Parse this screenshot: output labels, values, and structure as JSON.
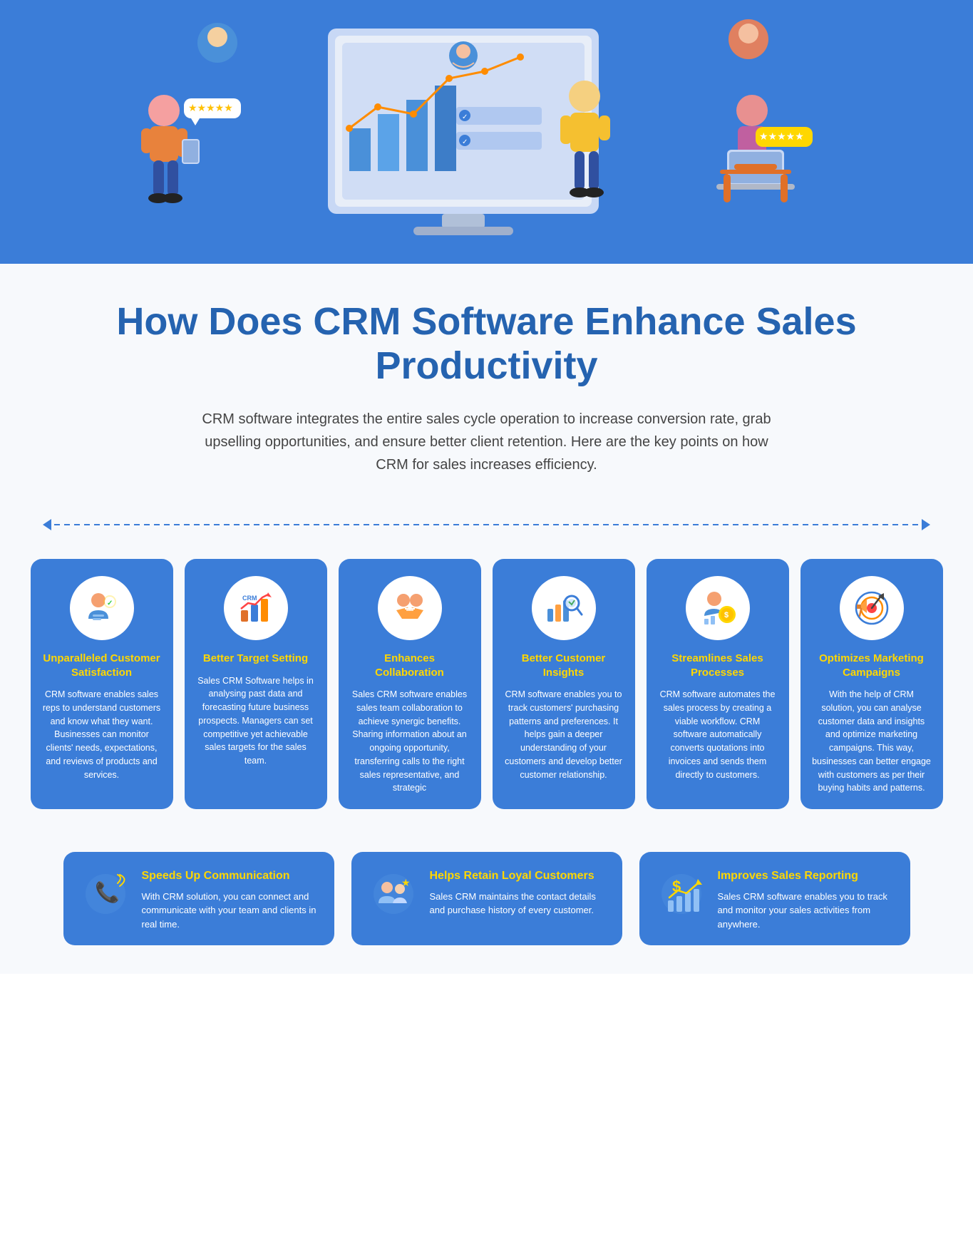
{
  "hero": {
    "alt": "CRM Software illustration with people and monitor"
  },
  "title": {
    "main": "How Does CRM Software Enhance Sales Productivity",
    "subtitle": "CRM software integrates the entire sales cycle operation to increase conversion rate, grab upselling opportunities, and ensure better client retention. Here are the key points on how CRM for sales increases efficiency."
  },
  "cards": [
    {
      "id": "unparalleled-customer-satisfaction",
      "title": "Unparalleled Customer Satisfaction",
      "body": "CRM software enables sales reps to understand customers and know what they want. Businesses can monitor clients' needs, expectations, and reviews of products and services.",
      "icon": "person-checkmark"
    },
    {
      "id": "better-target-setting",
      "title": "Better Target Setting",
      "body": "Sales CRM Software helps in analysing past data and forecasting future business prospects. Managers can set competitive yet achievable sales targets for the sales team.",
      "icon": "crm-chart"
    },
    {
      "id": "enhances-collaboration",
      "title": "Enhances Collaboration",
      "body": "Sales CRM software enables sales team collaboration to achieve synergic benefits. Sharing information about an ongoing opportunity, transferring calls to the right sales representative, and strategic",
      "icon": "handshake"
    },
    {
      "id": "better-customer-insights",
      "title": "Better Customer Insights",
      "body": "CRM software enables you to track customers' purchasing patterns and preferences. It helps gain a deeper understanding of your customers and develop better customer relationship.",
      "icon": "magnifier-chart"
    },
    {
      "id": "streamlines-sales-processes",
      "title": "Streamlines Sales Processes",
      "body": "CRM software automates the sales process by creating a viable workflow. CRM software automatically converts quotations into invoices and sends them directly to customers.",
      "icon": "person-coin"
    },
    {
      "id": "optimizes-marketing-campaigns",
      "title": "Optimizes Marketing Campaigns",
      "body": "With the help of CRM solution, you can analyse customer data and insights and optimize marketing campaigns. This way, businesses can better engage with customers as per their buying habits and patterns.",
      "icon": "target-arrow"
    }
  ],
  "bottom_cards": [
    {
      "id": "speeds-up-communication",
      "title": "Speeds Up Communication",
      "body": "With CRM solution, you can connect and communicate with your team and clients in real time.",
      "icon": "phone-network"
    },
    {
      "id": "helps-retain-loyal-customers",
      "title": "Helps Retain Loyal Customers",
      "body": "Sales CRM maintains the contact details and purchase history of every customer.",
      "icon": "people-star"
    },
    {
      "id": "improves-sales-reporting",
      "title": "Improves Sales Reporting",
      "body": "Sales CRM software enables you to track and monitor your sales activities from anywhere.",
      "icon": "dollar-chart"
    }
  ]
}
